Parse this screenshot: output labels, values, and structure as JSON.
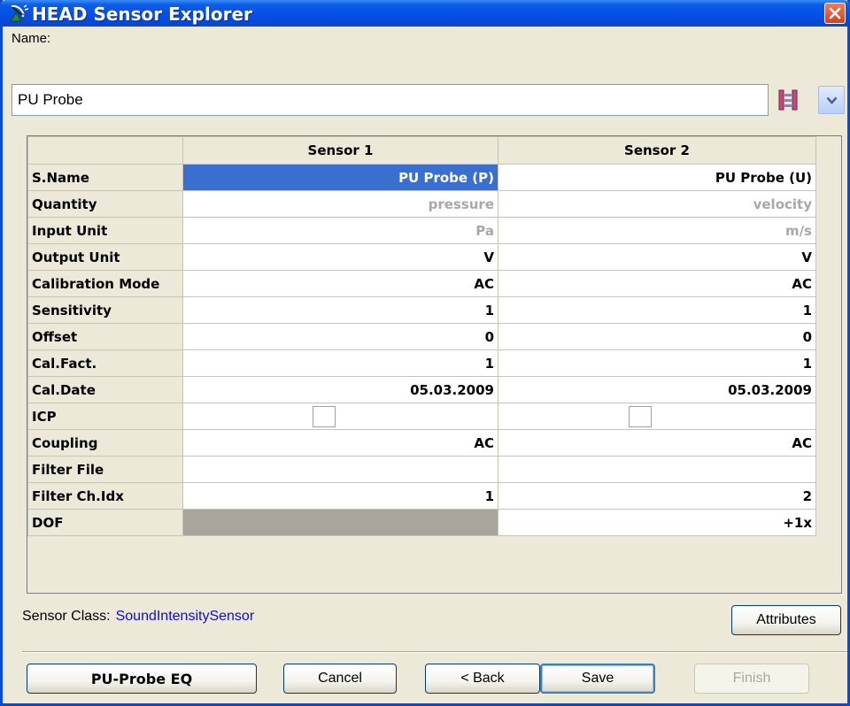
{
  "window": {
    "title": "HEAD Sensor Explorer",
    "icons": {
      "app": "satellite-antenna-icon",
      "close": "close-icon",
      "favorite": "pink-ladder-icon",
      "dropdown": "chevron-down-icon"
    }
  },
  "name_field": {
    "label": "Name:",
    "value": "PU Probe"
  },
  "grid": {
    "columns": [
      "Sensor 1",
      "Sensor 2"
    ],
    "rows": [
      {
        "label": "S.Name",
        "values": [
          "PU Probe (P)",
          "PU Probe (U)"
        ]
      },
      {
        "label": "Quantity",
        "values": [
          "pressure",
          "velocity"
        ]
      },
      {
        "label": "Input Unit",
        "values": [
          "Pa",
          "m/s"
        ]
      },
      {
        "label": "Output Unit",
        "values": [
          "V",
          "V"
        ]
      },
      {
        "label": "Calibration Mode",
        "values": [
          "AC",
          "AC"
        ]
      },
      {
        "label": "Sensitivity",
        "values": [
          "1",
          "1"
        ]
      },
      {
        "label": "Offset",
        "values": [
          "0",
          "0"
        ]
      },
      {
        "label": "Cal.Fact.",
        "values": [
          "1",
          "1"
        ]
      },
      {
        "label": "Cal.Date",
        "values": [
          "05.03.2009",
          "05.03.2009"
        ]
      },
      {
        "label": "ICP",
        "values": [
          false,
          false
        ]
      },
      {
        "label": "Coupling",
        "values": [
          "AC",
          "AC"
        ]
      },
      {
        "label": "Filter File",
        "values": [
          "",
          ""
        ]
      },
      {
        "label": "Filter Ch.Idx",
        "values": [
          "1",
          "2"
        ]
      },
      {
        "label": "DOF",
        "values": [
          "",
          "+1x"
        ]
      }
    ]
  },
  "sensor_class": {
    "label": "Sensor Class:",
    "value": "SoundIntensitySensor"
  },
  "buttons": {
    "attributes": "Attributes",
    "pu_probe_eq": "PU-Probe EQ",
    "cancel": "Cancel",
    "back": "< Back",
    "save": "Save",
    "finish": "Finish"
  },
  "colors": {
    "title_bar": "#0550e6",
    "selection": "#3a6fd0",
    "link": "#0d0dcf",
    "disabled_cell": "#aaa59a"
  }
}
